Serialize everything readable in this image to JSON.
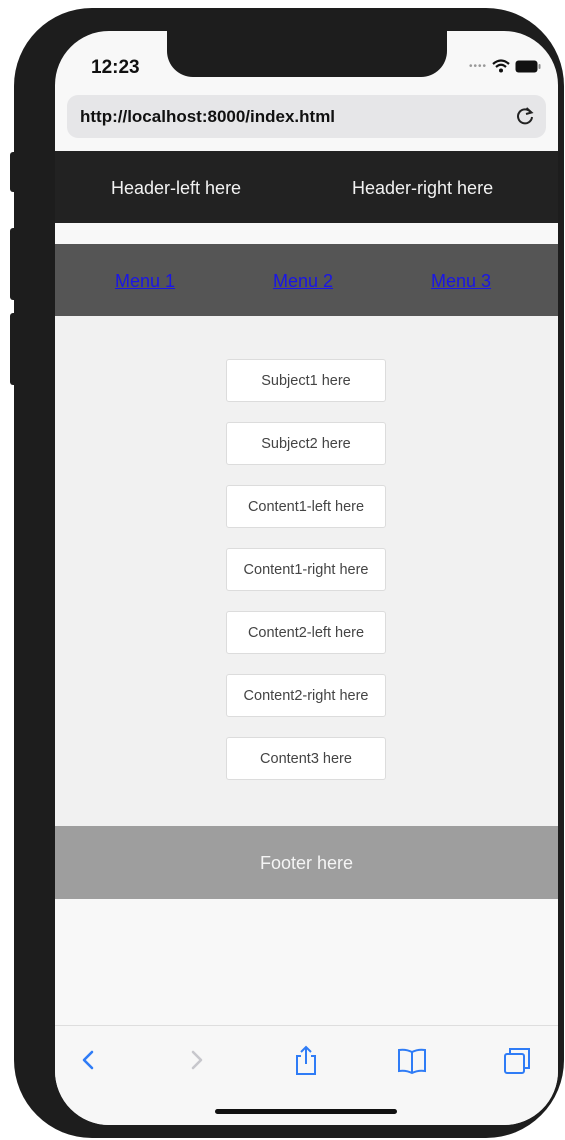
{
  "status_bar": {
    "time": "12:23",
    "icons": [
      "signal-dots-icon",
      "wifi-icon",
      "battery-icon"
    ]
  },
  "browser": {
    "url": "http://localhost:8000/index.html",
    "reload_icon": "reload-icon"
  },
  "header": {
    "left": "Header-left here",
    "right": "Header-right here",
    "background": "#222222"
  },
  "nav": {
    "items": [
      {
        "label": "Menu 1"
      },
      {
        "label": "Menu 2"
      },
      {
        "label": "Menu 3"
      }
    ],
    "link_color": "#1a16e6",
    "background": "#555555"
  },
  "content": {
    "boxes": [
      {
        "label": "Subject1 here"
      },
      {
        "label": "Subject2 here"
      },
      {
        "label": "Content1-left here"
      },
      {
        "label": "Content1-right here"
      },
      {
        "label": "Content2-left here"
      },
      {
        "label": "Content2-right here"
      },
      {
        "label": "Content3 here"
      }
    ]
  },
  "footer": {
    "text": "Footer here",
    "background": "#9e9e9e"
  },
  "toolbar": {
    "icons": [
      "back-icon",
      "forward-icon",
      "share-icon",
      "bookmarks-icon",
      "tabs-icon"
    ],
    "accent": "#2f7cf6"
  }
}
